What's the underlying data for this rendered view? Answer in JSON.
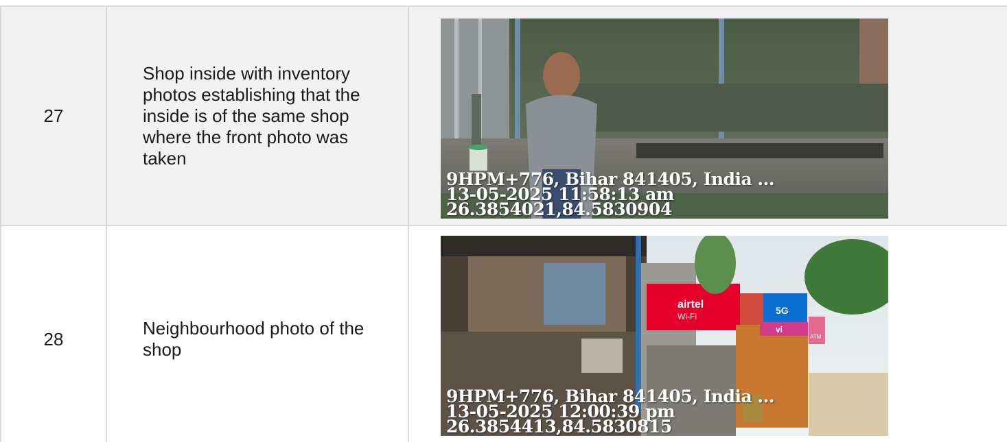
{
  "rows": [
    {
      "number": "27",
      "description": "Shop inside with inventory photos establishing that the inside is of the same shop where the front photo was taken",
      "photo": {
        "address": "9HPM+776, Bihar 841405, India ...",
        "timestamp": "13-05-2025 11:58:13 am",
        "coordinates": "26.3854021,84.5830904"
      }
    },
    {
      "number": "28",
      "description": "Neighbourhood photo of the shop",
      "photo": {
        "address": "9HPM+776, Bihar 841405, India ...",
        "timestamp": "13-05-2025 12:00:39 pm",
        "coordinates": "26.3854413,84.5830815"
      }
    }
  ],
  "colors": {
    "border": "#d9d9d9",
    "row_shaded": "#f2f2f2",
    "airtel_red": "#e4002b",
    "jio_blue": "#0a6fd1"
  },
  "signage": {
    "brand": "airtel",
    "service": "Wi-Fi",
    "jio_label": "5G",
    "atm_label": "ATM",
    "vi_label": "vi"
  }
}
